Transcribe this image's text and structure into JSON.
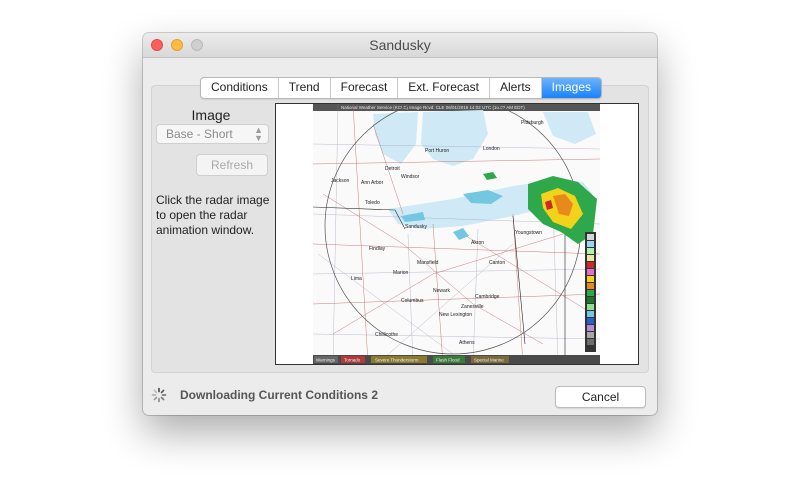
{
  "window": {
    "title": "Sandusky"
  },
  "tabs": [
    {
      "label": "Conditions",
      "active": false
    },
    {
      "label": "Trend",
      "active": false
    },
    {
      "label": "Forecast",
      "active": false
    },
    {
      "label": "Ext. Forecast",
      "active": false
    },
    {
      "label": "Alerts",
      "active": false
    },
    {
      "label": "Images",
      "active": true
    }
  ],
  "sidebar": {
    "heading": "Image",
    "image_select_value": "Base - Short",
    "refresh_label": "Refresh",
    "instructions": "Click the radar image to open the radar animation window."
  },
  "radar": {
    "header": "National Weather Service (KCLE) Image Rcvd: CLE 06/01/2016 14:02 UTC (10:02 AM EDT)",
    "cities": [
      "Port Huron",
      "London",
      "Pittsburgh",
      "Sandusky",
      "Toledo",
      "Detroit",
      "Jackson",
      "Ann Arbor",
      "Windsor",
      "Findlay",
      "Lima",
      "Mansfield",
      "Canton",
      "Columbus",
      "Zanesville",
      "Cambridge",
      "Newark",
      "Marion",
      "Akron",
      "Youngstown",
      "New Lexington",
      "Chillicothe",
      "Athens"
    ],
    "legend_tags": [
      "Warnings",
      "Tornado",
      "Severe Thunderstorm",
      "Flash Flood",
      "Special Marine"
    ],
    "colors": {
      "rain_green": "#2ea84a",
      "heavy_yellow": "#f2d21b",
      "lake_blue": "#cfe9f6"
    }
  },
  "status": {
    "text": "Downloading Current Conditions 2"
  },
  "footer": {
    "cancel_label": "Cancel"
  }
}
